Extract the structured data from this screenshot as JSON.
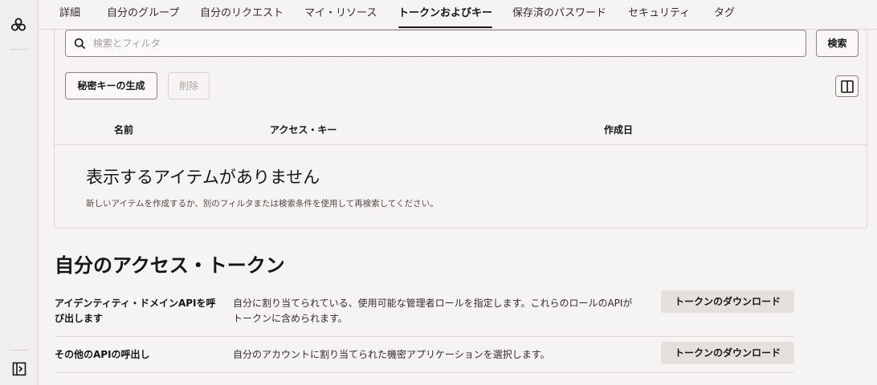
{
  "tabs": [
    {
      "label": "詳細"
    },
    {
      "label": "自分のグループ"
    },
    {
      "label": "自分のリクエスト"
    },
    {
      "label": "マイ・リソース"
    },
    {
      "label": "トークンおよびキー",
      "active": true
    },
    {
      "label": "保存済のパスワード"
    },
    {
      "label": "セキュリティ"
    },
    {
      "label": "タグ"
    }
  ],
  "search": {
    "placeholder": "検索とフィルタ",
    "button_label": "検索"
  },
  "toolbar": {
    "generate_label": "秘密キーの生成",
    "delete_label": "削除"
  },
  "table": {
    "columns": [
      "名前",
      "アクセス・キー",
      "作成日"
    ],
    "empty_title": "表示するアイテムがありません",
    "empty_message": "新しいアイテムを作成するか、別のフィルタまたは検索条件を使用して再検索してください。"
  },
  "tokens": {
    "title": "自分のアクセス・トークン",
    "rows": [
      {
        "label_line1": "アイデンティティ・ドメインAPIを呼",
        "label_line2": "び出します",
        "desc_line1": "自分に割り当てられている、使用可能な管理者ロールを指定します。これらのロールのAPIが",
        "desc_line2": "トークンに含められます。",
        "button_label": "トークンのダウンロード"
      },
      {
        "label_line1": "その他のAPIの呼出し",
        "desc_line1": "自分のアカウントに割り当てられた機密アプリケーションを選択します。",
        "button_label": "トークンのダウンロード"
      }
    ]
  },
  "icons": {
    "logo": "oracle-cloud-logo-icon",
    "search": "search-icon",
    "columns": "columns-toggle-icon",
    "expand": "expand-sidebar-icon"
  }
}
